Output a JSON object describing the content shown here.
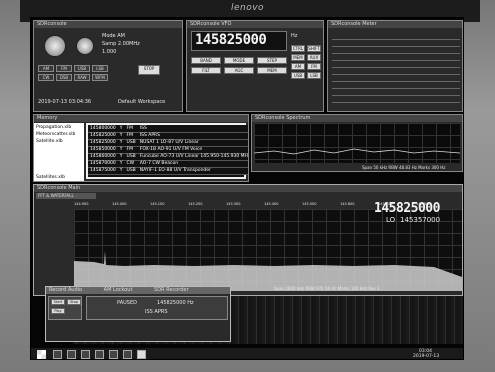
{
  "monitor": {
    "brand": "lenovo"
  },
  "control": {
    "title": "SDRconsole",
    "mode_lbl": "Mode AM",
    "clock": "2019-07-13 03:04:36",
    "workspace": "Default Workspace",
    "rate": "1.000",
    "sample": "Samp 2.00MHz",
    "stop": "STOP",
    "buttons": [
      "AM",
      "FM",
      "USB",
      "LSB",
      "CW",
      "DSB",
      "RAW",
      "WFM"
    ],
    "side": [
      "LSB",
      "USB",
      "CW",
      "FM"
    ]
  },
  "vfo": {
    "title": "SDRconsole VFO",
    "frequency": "145825000",
    "unit": "Hz",
    "labels": [
      "BAND",
      "MODE",
      "STEP",
      "FILT",
      "AGC",
      "MEM"
    ],
    "hints": [
      "CTRL",
      "SHIFT",
      "MEM",
      "AUX",
      "AM",
      "FM",
      "USB",
      "LSB"
    ]
  },
  "smeter": {
    "title": "SDRconsole Meter"
  },
  "memory": {
    "title": "Memory",
    "files": [
      "Propagation.xlb",
      "Meteorscatter.xlb",
      "Satellite.xlb",
      "Satellites.xlb"
    ],
    "rows": [
      {
        "freq": "145800000",
        "flag": "Y",
        "mode": "FM",
        "desc": "ISS"
      },
      {
        "freq": "145825000",
        "flag": "Y",
        "mode": "FM",
        "desc": "ISS APRS"
      },
      {
        "freq": "145825000",
        "flag": "Y",
        "mode": "USB",
        "desc": "NUSAT 1 LO-87 U/V Linear"
      },
      {
        "freq": "145850000",
        "flag": "Y",
        "mode": "FM",
        "desc": "FOX-1B AO-91 U/V FM Voice"
      },
      {
        "freq": "145860000",
        "flag": "Y",
        "mode": "USB",
        "desc": "Funcube AO-73 U/V Linear 145.950-145.930 MHz"
      },
      {
        "freq": "145870000",
        "flag": "Y",
        "mode": "CW",
        "desc": "AO-7 CW Beacon"
      },
      {
        "freq": "145875000",
        "flag": "Y",
        "mode": "USB",
        "desc": "NAYIF-1 EO-88 U/V Transponder"
      }
    ]
  },
  "spectrum_small": {
    "title": "SDRconsole Spectrum",
    "footer": "Span 50 kHz  RBW 48.83 Hz  Marks 300 Hz"
  },
  "main": {
    "title": "SDRconsole Main",
    "tab": "FFT & WATERFALL",
    "big_freq": "145825000",
    "lo_label": "LO",
    "lo_freq": "145357000",
    "footer": "Span 2000 kHz  RBW 976.56 Hz  Marks 100 kHz  Res 3",
    "ticks": [
      "144.900",
      "145.000",
      "145.100",
      "145.200",
      "145.300",
      "145.400",
      "145.500",
      "145.600",
      "145.700",
      "145.800"
    ]
  },
  "record": {
    "title": "Record Audio",
    "tab2": "AM Lockout",
    "tab3": "SDR Recorder",
    "status": "PAUSED",
    "freq_text": "145825000 Hz",
    "note": "ISS APRS",
    "buttons": [
      "Start",
      "Stop",
      "Play"
    ]
  },
  "taskbar": {
    "time": "03:04",
    "date": "2019-07-13"
  }
}
